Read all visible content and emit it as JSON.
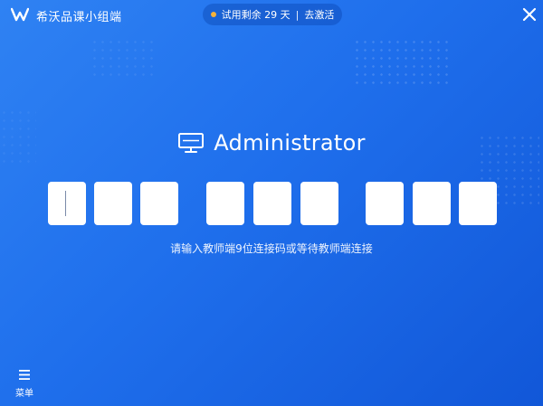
{
  "titlebar": {
    "app_title": "希沃品课小组端",
    "trial_text": "试用剩余 29 天",
    "separator": "|",
    "activate_label": "去激活"
  },
  "main": {
    "user_name": "Administrator",
    "code_box_count": 9,
    "hint": "请输入教师端9位连接码或等待教师端连接"
  },
  "bottom": {
    "menu_label": "菜单"
  },
  "icons": {
    "logo": "seewo-logo-icon",
    "close": "close-icon",
    "monitor": "monitor-icon",
    "menu": "hamburger-menu-icon",
    "status_dot": "status-dot-icon"
  },
  "colors": {
    "background_start": "#2f82f3",
    "background_end": "#1157d8",
    "status_dot": "#f5b23a",
    "input_box": "#ffffff"
  }
}
